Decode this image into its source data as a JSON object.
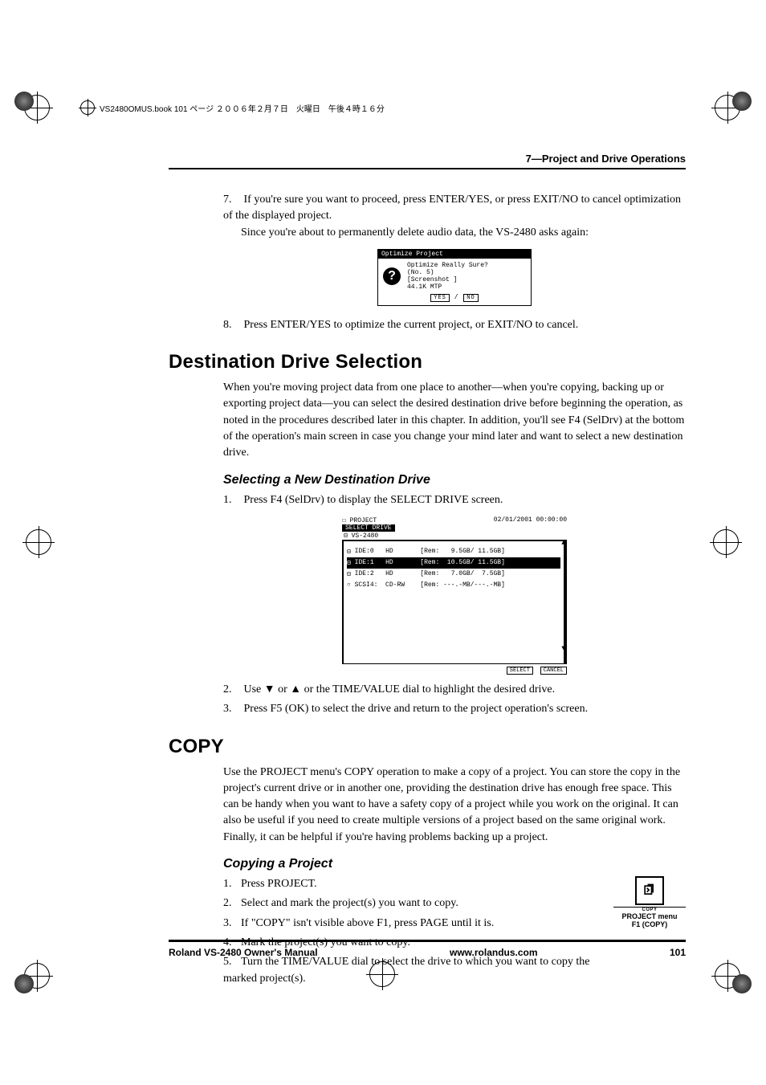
{
  "meta_header": "VS2480OMUS.book 101 ページ ２００６年２月７日　火曜日　午後４時１６分",
  "chapter_header": "7—Project and Drive Operations",
  "optimize": {
    "step7": {
      "n": "7.",
      "text": "If you're sure you want to proceed, press ENTER/YES, or press EXIT/NO to cancel optimization of the displayed project.",
      "sub": "Since you're about to permanently delete audio data, the VS-2480 asks again:"
    },
    "dialog": {
      "title": "Optimize Project",
      "line1": "Optimize Really Sure?",
      "line2": "(No.  5)",
      "line3": "[Screenshot   ]",
      "line4": "44.1K MTP",
      "yes": "YES",
      "no": "NO"
    },
    "step8": {
      "n": "8.",
      "text": "Press ENTER/YES to optimize the current project, or EXIT/NO to cancel."
    }
  },
  "dest": {
    "heading": "Destination Drive Selection",
    "para": "When you're moving project data from one place to another—when you're copying, backing up or exporting project data—you can select the desired destination drive before beginning the operation, as noted in the procedures described later in this chapter. In addition, you'll see F4 (SelDrv) at the bottom of the operation's main screen in case you change your mind later and want to select a new destination drive.",
    "sub": "Selecting a New Destination Drive",
    "step1": {
      "n": "1.",
      "text": "Press F4 (SelDrv) to display the SELECT DRIVE screen."
    },
    "screen": {
      "top_left": "PROJECT",
      "timestamp": "02/01/2001 00:00:00",
      "label": "SELECT DRIVE",
      "model": "VS-2480",
      "rows": [
        {
          "icon": "⊟",
          "id": "IDE:0",
          "type": "HD",
          "rem": "[Rem:   9.5GB/ 11.5GB]",
          "sel": false
        },
        {
          "icon": "⊟",
          "id": "IDE:1",
          "type": "HD",
          "rem": "[Rem:  10.5GB/ 11.5GB]",
          "sel": true
        },
        {
          "icon": "⊟",
          "id": "IDE:2",
          "type": "HD",
          "rem": "[Rem:   7.0GB/  7.5GB]",
          "sel": false
        },
        {
          "icon": "○",
          "id": "SCSI4:",
          "type": "CD-RW",
          "rem": "[Rem: ---.-MB/---.-MB]",
          "sel": false
        }
      ],
      "btn_select": "SELECT",
      "btn_cancel": "CANCEL"
    },
    "step2": {
      "n": "2.",
      "text": "Use ▼ or ▲ or the TIME/VALUE dial to highlight the desired drive."
    },
    "step3": {
      "n": "3.",
      "text": "Press F5 (OK) to select the drive and return to the project operation's screen."
    }
  },
  "copy": {
    "heading": "COPY",
    "para": "Use the PROJECT menu's COPY operation to make a copy of a project. You can store the copy in the project's current drive or in another one, providing the destination drive has enough free space. This can be handy when you want to have a safety copy of a project while you work on the original. It can also be useful if you need to create multiple versions of a project based on the same original work. Finally, it can be helpful if you're having problems backing up a project.",
    "sub": "Copying a Project",
    "icon_under": "COPY",
    "icon_caption1": "PROJECT menu",
    "icon_caption2": "F1 (COPY)",
    "steps": [
      {
        "n": "1.",
        "text": "Press PROJECT."
      },
      {
        "n": "2.",
        "text": "Select and mark the project(s) you want to copy."
      },
      {
        "n": "3.",
        "text": "If \"COPY\" isn't visible above F1, press PAGE until it is."
      },
      {
        "n": "4.",
        "text": "Mark the project(s) you want to copy."
      },
      {
        "n": "5.",
        "text": "Turn the TIME/VALUE dial to select the drive to which you want to copy the marked project(s)."
      }
    ]
  },
  "footer": {
    "left": "Roland VS-2480 Owner's Manual",
    "center": "www.rolandus.com",
    "right": "101"
  }
}
